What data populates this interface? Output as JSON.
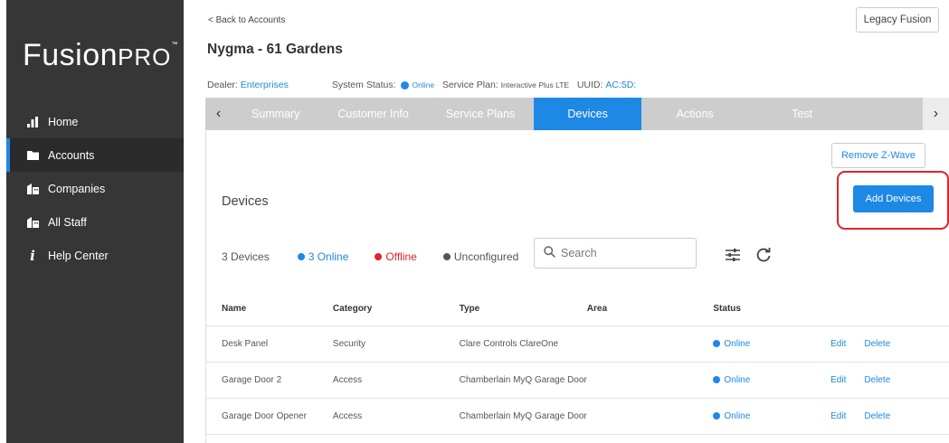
{
  "sidebar": {
    "logo_main": "Fusion",
    "logo_pro": "PRO",
    "logo_tm": "™",
    "items": [
      {
        "label": "Home",
        "icon": "bar-chart-icon"
      },
      {
        "label": "Accounts",
        "icon": "folder-icon",
        "active": true
      },
      {
        "label": "Companies",
        "icon": "building-icon"
      },
      {
        "label": "All Staff",
        "icon": "staff-icon"
      },
      {
        "label": "Help Center",
        "icon": "info-icon"
      }
    ]
  },
  "header": {
    "back_label": "< Back to Accounts",
    "legacy_label": "Legacy Fusion",
    "title": "Nygma - 61 Gardens",
    "dealer_label": "Dealer:",
    "dealer_value": "Enterprises",
    "system_status_label": "System Status:",
    "system_status_value": "Online",
    "service_plan_label": "Service Plan:",
    "service_plan_value": "Interactive Plus LTE",
    "uuid_label": "UUID:",
    "uuid_value": "AC:5D:"
  },
  "tabs": {
    "prev_icon": "‹",
    "next_icon": "›",
    "items": [
      "Summary",
      "Customer Info",
      "Service Plans",
      "Devices",
      "Actions",
      "Test"
    ],
    "active": "Devices"
  },
  "devices": {
    "remove_zwave_label": "Remove Z-Wave",
    "section_title": "Devices",
    "add_devices_label": "Add Devices",
    "count_label": "3 Devices",
    "online_label": "3 Online",
    "offline_label": "Offline",
    "unconfigured_label": "Unconfigured",
    "search_placeholder": "Search",
    "columns": [
      "Name",
      "Category",
      "Type",
      "Area",
      "Status"
    ],
    "rows": [
      {
        "name": "Desk Panel",
        "category": "Security",
        "type": "Clare Controls ClareOne",
        "area": "",
        "status": "Online",
        "edit": "Edit",
        "delete": "Delete"
      },
      {
        "name": "Garage Door 2",
        "category": "Access",
        "type": "Chamberlain MyQ Garage Door",
        "area": "",
        "status": "Online",
        "edit": "Edit",
        "delete": "Delete"
      },
      {
        "name": "Garage Door Opener",
        "category": "Access",
        "type": "Chamberlain MyQ Garage Door",
        "area": "",
        "status": "Online",
        "edit": "Edit",
        "delete": "Delete"
      }
    ]
  },
  "colors": {
    "accent": "#1e88e5",
    "offline": "#e0232a",
    "unconfigured": "#555555",
    "sidebar_bg": "#363636",
    "highlight_border": "#e0232a"
  }
}
